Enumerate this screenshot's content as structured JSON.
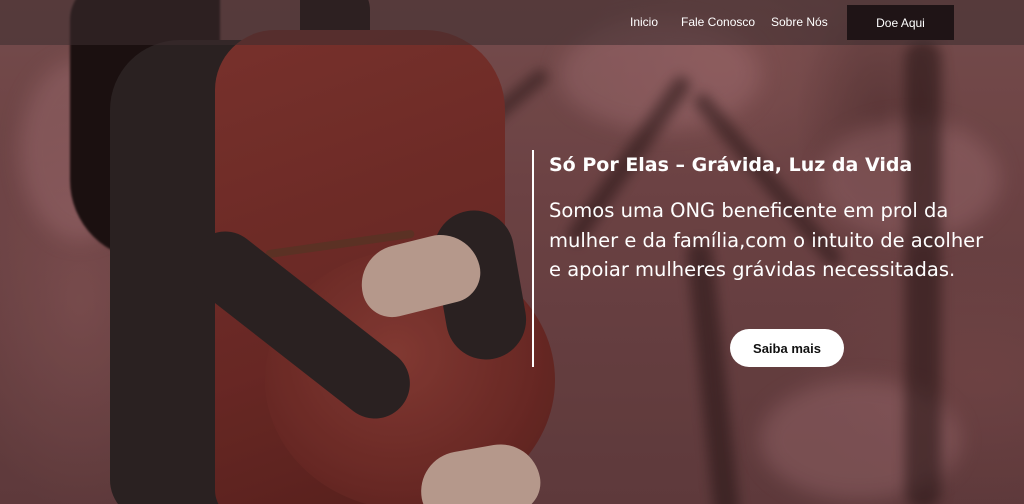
{
  "nav": {
    "items": [
      {
        "label": "Inicio"
      },
      {
        "label": "Fale Conosco"
      },
      {
        "label": "Sobre Nós"
      }
    ],
    "donate_label": "Doe Aqui"
  },
  "hero": {
    "title": "Só Por Elas – Grávida, Luz da Vida",
    "description": "Somos uma ONG beneficente em prol da mulher e da família,com o intuito de acolher e apoiar mulheres grávidas necessitadas.",
    "cta_label": "Saiba mais"
  },
  "colors": {
    "navbar_bg": "#3c2d30",
    "donate_bg": "#1f1416",
    "text": "#ffffff",
    "cta_bg": "#ffffff"
  }
}
